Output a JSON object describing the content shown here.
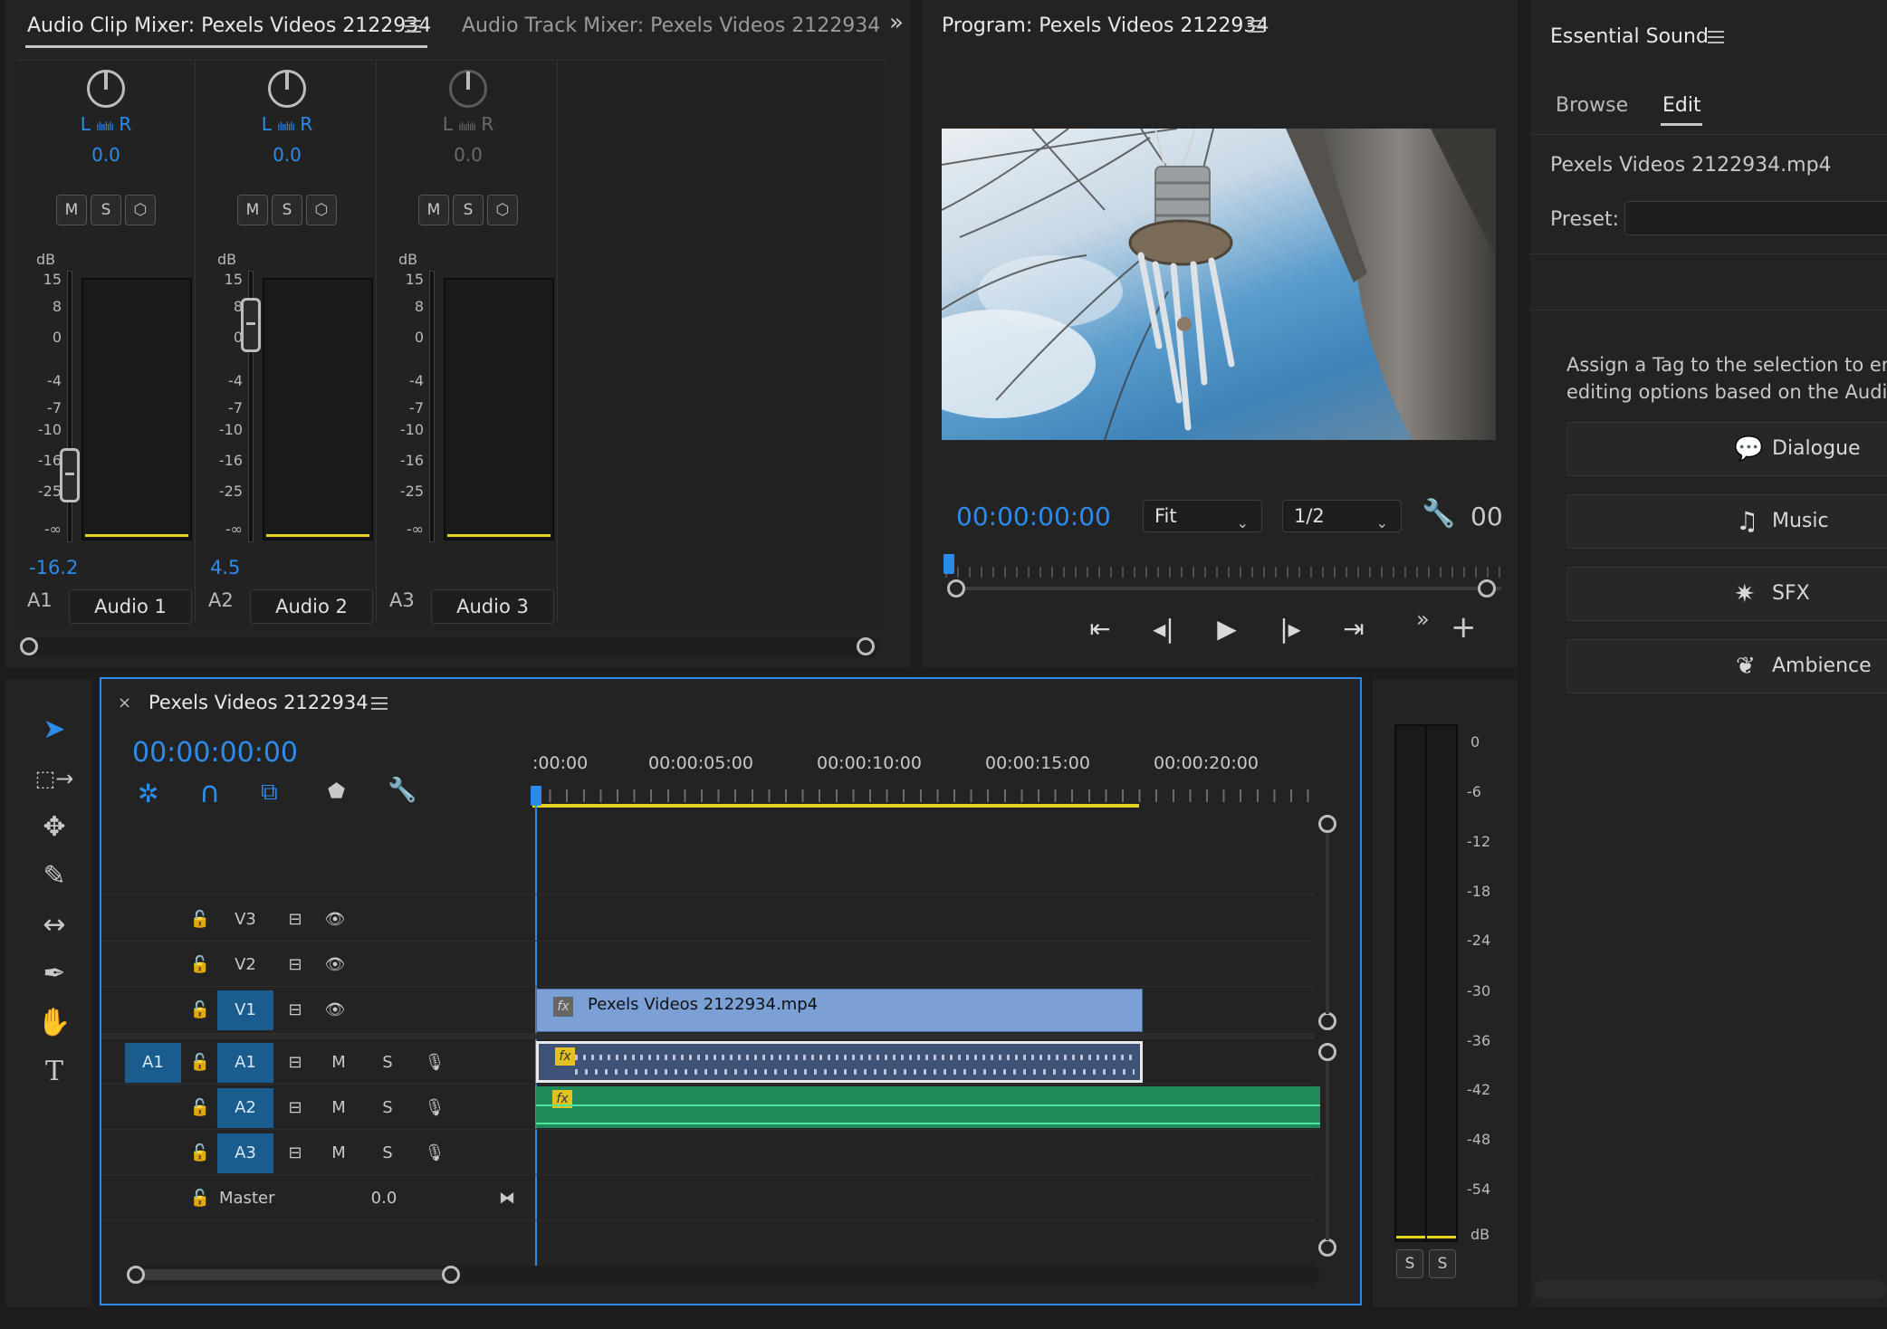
{
  "mixer": {
    "tab_active": "Audio Clip Mixer: Pexels Videos 2122934",
    "tab_inactive": "Audio Track Mixer: Pexels Videos 2122934",
    "db_label": "dB",
    "db_ticks": [
      "15",
      "8",
      "0",
      "-4",
      "-7",
      "-10",
      "-16",
      "-25",
      "-∞"
    ],
    "btn_m": "M",
    "btn_s": "S",
    "strips": [
      {
        "lr_l": "L",
        "lr_r": "R",
        "pan": "0.0",
        "volume": "-16.2",
        "track": "A1",
        "name": "Audio 1"
      },
      {
        "lr_l": "L",
        "lr_r": "R",
        "pan": "0.0",
        "volume": "4.5",
        "track": "A2",
        "name": "Audio 2"
      },
      {
        "lr_l": "L",
        "lr_r": "R",
        "pan": "0.0",
        "volume": "",
        "track": "A3",
        "name": "Audio 3"
      }
    ]
  },
  "program": {
    "title": "Program: Pexels Videos 2122934",
    "timecode": "00:00:00:00",
    "fit": "Fit",
    "resolution": "1/2",
    "duration_partial": "00"
  },
  "essential": {
    "title": "Essential Sound",
    "tab_browse": "Browse",
    "tab_edit": "Edit",
    "clip_name": "Pexels Videos 2122934.mp4",
    "preset_label": "Preset:",
    "assign_line1": "Assign a Tag to the selection to enab",
    "assign_line2": "editing options based on the Audio T",
    "tags": [
      "Dialogue",
      "Music",
      "SFX",
      "Ambience"
    ]
  },
  "timeline": {
    "sequence": "Pexels Videos 2122934",
    "timecode": "00:00:00:00",
    "ruler": [
      ":00:00",
      "00:00:05:00",
      "00:00:10:00",
      "00:00:15:00",
      "00:00:20:00"
    ],
    "tracks": {
      "v3": "V3",
      "v2": "V2",
      "v1": "V1",
      "a1_src": "A1",
      "a1": "A1",
      "a2": "A2",
      "a3": "A3",
      "m": "M",
      "s": "S",
      "master": "Master",
      "master_val": "0.0"
    },
    "clip_name": "Pexels Videos 2122934.mp4",
    "fx": "fx"
  },
  "meter": {
    "scale": [
      "0",
      "-6",
      "-12",
      "-18",
      "-24",
      "-30",
      "-36",
      "-42",
      "-48",
      "-54",
      "dB"
    ],
    "solo": "S"
  }
}
